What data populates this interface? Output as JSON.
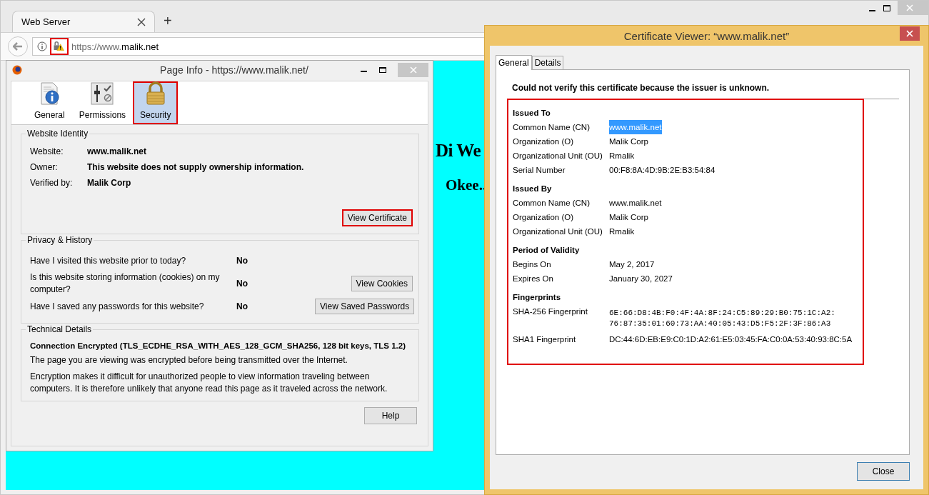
{
  "browser": {
    "tab": {
      "title": "Web Server"
    },
    "new_tab": "+",
    "url": {
      "scheme": "https://www.",
      "host": "malik.net"
    },
    "page": {
      "heading": "Di We",
      "subheading": "Okee.."
    }
  },
  "page_info": {
    "title": "Page Info - https://www.malik.net/",
    "tabs": [
      {
        "label": "General",
        "selected": false
      },
      {
        "label": "Permissions",
        "selected": false
      },
      {
        "label": "Security",
        "selected": true
      }
    ],
    "website_identity": {
      "legend": "Website Identity",
      "rows": [
        {
          "label": "Website:",
          "value": "www.malik.net"
        },
        {
          "label": "Owner:",
          "value": "This website does not supply ownership information."
        },
        {
          "label": "Verified by:",
          "value": "Malik Corp"
        }
      ],
      "button": "View Certificate"
    },
    "privacy_history": {
      "legend": "Privacy & History",
      "rows": [
        {
          "question": "Have I visited this website prior to today?",
          "answer": "No"
        },
        {
          "question": "Is this website storing information (cookies) on my computer?",
          "answer": "No",
          "button": "View Cookies"
        },
        {
          "question": "Have I saved any passwords for this website?",
          "answer": "No",
          "button": "View Saved Passwords"
        }
      ]
    },
    "technical_details": {
      "legend": "Technical Details",
      "heading": "Connection Encrypted (TLS_ECDHE_RSA_WITH_AES_128_GCM_SHA256, 128 bit keys, TLS 1.2)",
      "paragraphs": [
        "The page you are viewing was encrypted before being transmitted over the Internet.",
        "Encryption makes it difficult for unauthorized people to view information traveling between computers. It is therefore unlikely that anyone read this page as it traveled across the network."
      ]
    },
    "help_button": "Help"
  },
  "certificate_viewer": {
    "title": "Certificate Viewer: “www.malik.net”",
    "tabs": [
      {
        "label": "General",
        "selected": true
      },
      {
        "label": "Details",
        "selected": false
      }
    ],
    "warning": "Could not verify this certificate because the issuer is unknown.",
    "sections": [
      {
        "title": "Issued To",
        "rows": [
          {
            "label": "Common Name (CN)",
            "value": "www.malik.net",
            "highlighted": true
          },
          {
            "label": "Organization (O)",
            "value": "Malik Corp",
            "highlighted": false
          },
          {
            "label": "Organizational Unit (OU)",
            "value": "Rmalik",
            "highlighted": false
          },
          {
            "label": "Serial Number",
            "value": "00:F8:8A:4D:9B:2E:B3:54:84",
            "highlighted": false
          }
        ]
      },
      {
        "title": "Issued By",
        "rows": [
          {
            "label": "Common Name (CN)",
            "value": "www.malik.net",
            "highlighted": false
          },
          {
            "label": "Organization (O)",
            "value": "Malik Corp",
            "highlighted": false
          },
          {
            "label": "Organizational Unit (OU)",
            "value": "Rmalik",
            "highlighted": false
          }
        ]
      },
      {
        "title": "Period of Validity",
        "rows": [
          {
            "label": "Begins On",
            "value": "May 2, 2017",
            "highlighted": false
          },
          {
            "label": "Expires On",
            "value": "January 30, 2027",
            "highlighted": false
          }
        ]
      },
      {
        "title": "Fingerprints",
        "rows": [
          {
            "label": "SHA-256 Fingerprint",
            "value": "6E:66:D8:4B:F0:4F:4A:8F:24:C5:89:29:B0:75:1C:A2:76:87:35:01:60:73:AA:40:05:43:D5:F5:2F:3F:86:A3",
            "highlighted": false,
            "kind": "mono"
          },
          {
            "label": "SHA1 Fingerprint",
            "value": "DC:44:6D:EB:E9:C0:1D:A2:61:E5:03:45:FA:C0:0A:53:40:93:8C:5A",
            "highlighted": false,
            "kind": "text"
          }
        ]
      }
    ],
    "close_button": "Close"
  }
}
